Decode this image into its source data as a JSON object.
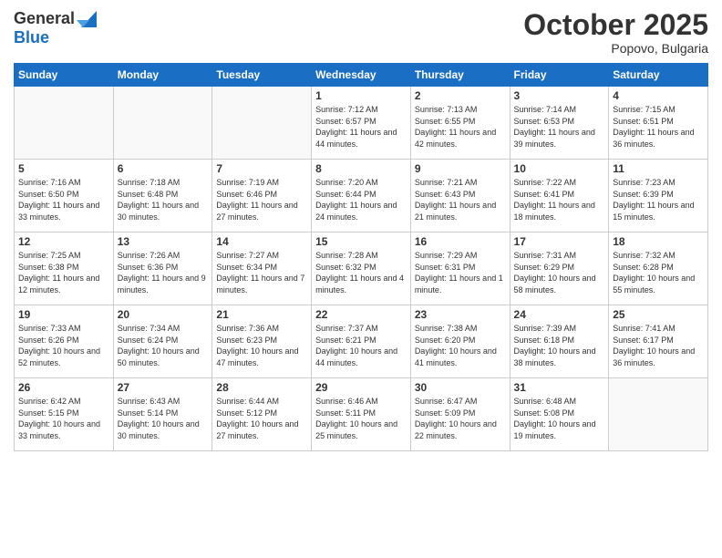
{
  "logo": {
    "general": "General",
    "blue": "Blue"
  },
  "header": {
    "month": "October 2025",
    "location": "Popovo, Bulgaria"
  },
  "weekdays": [
    "Sunday",
    "Monday",
    "Tuesday",
    "Wednesday",
    "Thursday",
    "Friday",
    "Saturday"
  ],
  "weeks": [
    [
      {
        "day": "",
        "sunrise": "",
        "sunset": "",
        "daylight": ""
      },
      {
        "day": "",
        "sunrise": "",
        "sunset": "",
        "daylight": ""
      },
      {
        "day": "",
        "sunrise": "",
        "sunset": "",
        "daylight": ""
      },
      {
        "day": "1",
        "sunrise": "Sunrise: 7:12 AM",
        "sunset": "Sunset: 6:57 PM",
        "daylight": "Daylight: 11 hours and 44 minutes."
      },
      {
        "day": "2",
        "sunrise": "Sunrise: 7:13 AM",
        "sunset": "Sunset: 6:55 PM",
        "daylight": "Daylight: 11 hours and 42 minutes."
      },
      {
        "day": "3",
        "sunrise": "Sunrise: 7:14 AM",
        "sunset": "Sunset: 6:53 PM",
        "daylight": "Daylight: 11 hours and 39 minutes."
      },
      {
        "day": "4",
        "sunrise": "Sunrise: 7:15 AM",
        "sunset": "Sunset: 6:51 PM",
        "daylight": "Daylight: 11 hours and 36 minutes."
      }
    ],
    [
      {
        "day": "5",
        "sunrise": "Sunrise: 7:16 AM",
        "sunset": "Sunset: 6:50 PM",
        "daylight": "Daylight: 11 hours and 33 minutes."
      },
      {
        "day": "6",
        "sunrise": "Sunrise: 7:18 AM",
        "sunset": "Sunset: 6:48 PM",
        "daylight": "Daylight: 11 hours and 30 minutes."
      },
      {
        "day": "7",
        "sunrise": "Sunrise: 7:19 AM",
        "sunset": "Sunset: 6:46 PM",
        "daylight": "Daylight: 11 hours and 27 minutes."
      },
      {
        "day": "8",
        "sunrise": "Sunrise: 7:20 AM",
        "sunset": "Sunset: 6:44 PM",
        "daylight": "Daylight: 11 hours and 24 minutes."
      },
      {
        "day": "9",
        "sunrise": "Sunrise: 7:21 AM",
        "sunset": "Sunset: 6:43 PM",
        "daylight": "Daylight: 11 hours and 21 minutes."
      },
      {
        "day": "10",
        "sunrise": "Sunrise: 7:22 AM",
        "sunset": "Sunset: 6:41 PM",
        "daylight": "Daylight: 11 hours and 18 minutes."
      },
      {
        "day": "11",
        "sunrise": "Sunrise: 7:23 AM",
        "sunset": "Sunset: 6:39 PM",
        "daylight": "Daylight: 11 hours and 15 minutes."
      }
    ],
    [
      {
        "day": "12",
        "sunrise": "Sunrise: 7:25 AM",
        "sunset": "Sunset: 6:38 PM",
        "daylight": "Daylight: 11 hours and 12 minutes."
      },
      {
        "day": "13",
        "sunrise": "Sunrise: 7:26 AM",
        "sunset": "Sunset: 6:36 PM",
        "daylight": "Daylight: 11 hours and 9 minutes."
      },
      {
        "day": "14",
        "sunrise": "Sunrise: 7:27 AM",
        "sunset": "Sunset: 6:34 PM",
        "daylight": "Daylight: 11 hours and 7 minutes."
      },
      {
        "day": "15",
        "sunrise": "Sunrise: 7:28 AM",
        "sunset": "Sunset: 6:32 PM",
        "daylight": "Daylight: 11 hours and 4 minutes."
      },
      {
        "day": "16",
        "sunrise": "Sunrise: 7:29 AM",
        "sunset": "Sunset: 6:31 PM",
        "daylight": "Daylight: 11 hours and 1 minute."
      },
      {
        "day": "17",
        "sunrise": "Sunrise: 7:31 AM",
        "sunset": "Sunset: 6:29 PM",
        "daylight": "Daylight: 10 hours and 58 minutes."
      },
      {
        "day": "18",
        "sunrise": "Sunrise: 7:32 AM",
        "sunset": "Sunset: 6:28 PM",
        "daylight": "Daylight: 10 hours and 55 minutes."
      }
    ],
    [
      {
        "day": "19",
        "sunrise": "Sunrise: 7:33 AM",
        "sunset": "Sunset: 6:26 PM",
        "daylight": "Daylight: 10 hours and 52 minutes."
      },
      {
        "day": "20",
        "sunrise": "Sunrise: 7:34 AM",
        "sunset": "Sunset: 6:24 PM",
        "daylight": "Daylight: 10 hours and 50 minutes."
      },
      {
        "day": "21",
        "sunrise": "Sunrise: 7:36 AM",
        "sunset": "Sunset: 6:23 PM",
        "daylight": "Daylight: 10 hours and 47 minutes."
      },
      {
        "day": "22",
        "sunrise": "Sunrise: 7:37 AM",
        "sunset": "Sunset: 6:21 PM",
        "daylight": "Daylight: 10 hours and 44 minutes."
      },
      {
        "day": "23",
        "sunrise": "Sunrise: 7:38 AM",
        "sunset": "Sunset: 6:20 PM",
        "daylight": "Daylight: 10 hours and 41 minutes."
      },
      {
        "day": "24",
        "sunrise": "Sunrise: 7:39 AM",
        "sunset": "Sunset: 6:18 PM",
        "daylight": "Daylight: 10 hours and 38 minutes."
      },
      {
        "day": "25",
        "sunrise": "Sunrise: 7:41 AM",
        "sunset": "Sunset: 6:17 PM",
        "daylight": "Daylight: 10 hours and 36 minutes."
      }
    ],
    [
      {
        "day": "26",
        "sunrise": "Sunrise: 6:42 AM",
        "sunset": "Sunset: 5:15 PM",
        "daylight": "Daylight: 10 hours and 33 minutes."
      },
      {
        "day": "27",
        "sunrise": "Sunrise: 6:43 AM",
        "sunset": "Sunset: 5:14 PM",
        "daylight": "Daylight: 10 hours and 30 minutes."
      },
      {
        "day": "28",
        "sunrise": "Sunrise: 6:44 AM",
        "sunset": "Sunset: 5:12 PM",
        "daylight": "Daylight: 10 hours and 27 minutes."
      },
      {
        "day": "29",
        "sunrise": "Sunrise: 6:46 AM",
        "sunset": "Sunset: 5:11 PM",
        "daylight": "Daylight: 10 hours and 25 minutes."
      },
      {
        "day": "30",
        "sunrise": "Sunrise: 6:47 AM",
        "sunset": "Sunset: 5:09 PM",
        "daylight": "Daylight: 10 hours and 22 minutes."
      },
      {
        "day": "31",
        "sunrise": "Sunrise: 6:48 AM",
        "sunset": "Sunset: 5:08 PM",
        "daylight": "Daylight: 10 hours and 19 minutes."
      },
      {
        "day": "",
        "sunrise": "",
        "sunset": "",
        "daylight": ""
      }
    ]
  ]
}
